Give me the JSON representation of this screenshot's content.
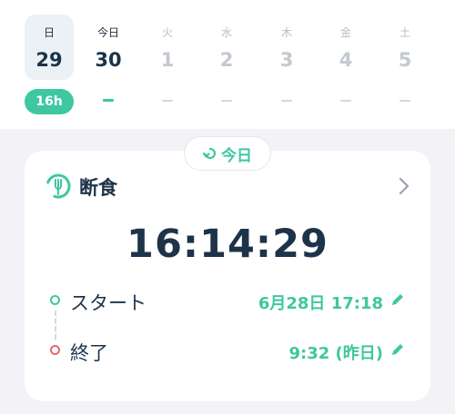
{
  "week": {
    "days": [
      {
        "name": "日",
        "number": "29",
        "state": "past"
      },
      {
        "name": "今日",
        "number": "30",
        "state": "today"
      },
      {
        "name": "火",
        "number": "1",
        "state": "future"
      },
      {
        "name": "水",
        "number": "2",
        "state": "future"
      },
      {
        "name": "木",
        "number": "3",
        "state": "future"
      },
      {
        "name": "金",
        "number": "4",
        "state": "future"
      },
      {
        "name": "土",
        "number": "5",
        "state": "future"
      }
    ],
    "selected_badge": "16h"
  },
  "today_button": {
    "label": "今日",
    "icon": "return-arrow-icon"
  },
  "fast_card": {
    "icon": "plate-fork-icon",
    "title": "断食",
    "timer": "16:14:29",
    "start": {
      "label": "スタート",
      "value": "6月28日 17:18"
    },
    "end": {
      "label": "終了",
      "value": "9:32 (昨日)"
    }
  },
  "colors": {
    "accent": "#3ec7a0",
    "end_dot": "#e56b6b",
    "text_dark": "#1d3349",
    "background": "#f2f2f7"
  }
}
